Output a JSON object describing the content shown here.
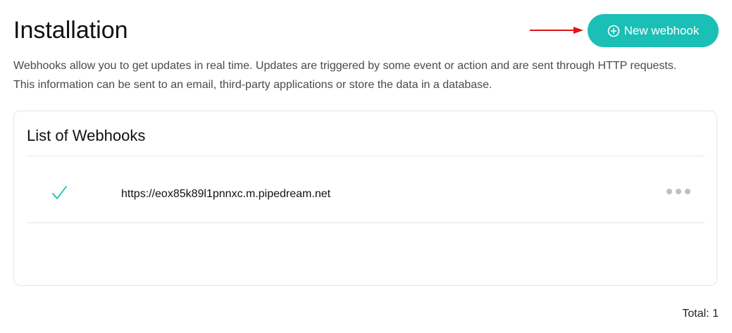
{
  "header": {
    "title": "Installation",
    "new_webhook_label": "New webhook",
    "button_icon": "plus-circle-icon",
    "annotation_arrow_color": "#e01414"
  },
  "description": {
    "line1": "Webhooks allow you to get updates in real time. Updates are triggered by some event or action and are sent through HTTP requests.",
    "line2": "This information can be sent to an email, third-party applications or store the data in a database."
  },
  "webhooks": {
    "title": "List of Webhooks",
    "items": [
      {
        "status_icon": "check-icon",
        "url": "https://eox85k89l1pnnxc.m.pipedream.net",
        "menu_icon": "more-horizontal-icon"
      }
    ]
  },
  "footer": {
    "total": "Total: 1"
  },
  "colors": {
    "accent": "#1abfb5",
    "border": "#e3e6e8",
    "menu_dots": "#b7c3c7"
  }
}
